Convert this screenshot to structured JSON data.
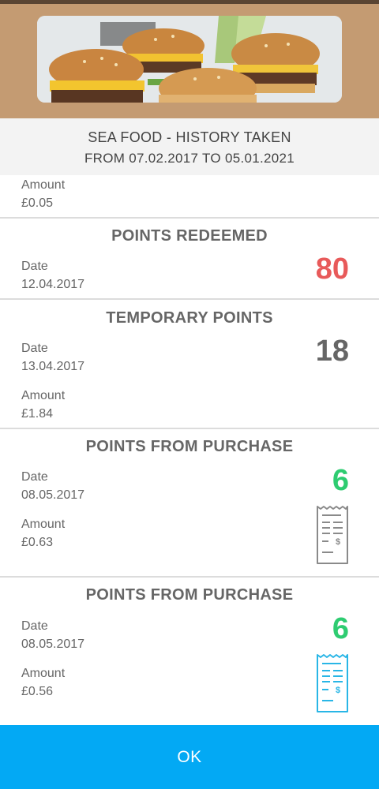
{
  "colors": {
    "accent": "#03a9f4",
    "redeemed": "#e85a5a",
    "purchase": "#2ecc71",
    "neutral": "#666666",
    "banner": "#c49b72"
  },
  "header": {
    "title": "SEA FOOD - HISTORY TAKEN",
    "range": "FROM 07.02.2017 TO 05.01.2021"
  },
  "top_partial": {
    "amount_label": "Amount",
    "amount": "£0.05"
  },
  "entries": [
    {
      "title": "POINTS REDEEMED",
      "date_label": "Date",
      "date": "12.04.2017",
      "points": "80",
      "icon": "none"
    },
    {
      "title": "TEMPORARY POINTS",
      "date_label": "Date",
      "date": "13.04.2017",
      "amount_label": "Amount",
      "amount": "£1.84",
      "points": "18",
      "icon": "none"
    },
    {
      "title": "POINTS FROM PURCHASE",
      "date_label": "Date",
      "date": "08.05.2017",
      "amount_label": "Amount",
      "amount": "£0.63",
      "points": "6",
      "icon": "receipt-icon-gray"
    },
    {
      "title": "POINTS FROM PURCHASE",
      "date_label": "Date",
      "date": "08.05.2017",
      "amount_label": "Amount",
      "amount": "£0.56",
      "points": "6",
      "icon": "receipt-icon-blue"
    }
  ],
  "footer": {
    "ok_label": "OK"
  }
}
